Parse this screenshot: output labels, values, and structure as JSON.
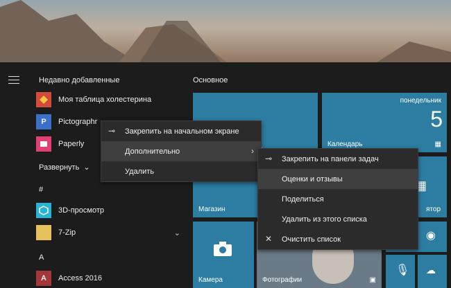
{
  "start_menu": {
    "recent_title": "Недавно добавленные",
    "main_title": "Основное",
    "recent_apps": [
      {
        "label": "Моя таблица холестерина",
        "icon": "cholesterol-app-icon",
        "color": "#d24c3a"
      },
      {
        "label": "Pictographr",
        "icon": "pictographr-icon",
        "color": "#3b6fc9"
      },
      {
        "label": "Paperly",
        "icon": "paperly-icon",
        "color": "#e23f72"
      }
    ],
    "expand_label": "Развернуть",
    "groups": [
      {
        "letter": "#",
        "apps": [
          {
            "label": "3D-просмотр",
            "icon": "3d-viewer-icon",
            "color": "#28b4d6"
          },
          {
            "label": "7-Zip",
            "icon": "folder-icon",
            "color": "#e4c15a"
          }
        ]
      },
      {
        "letter": "A",
        "apps": [
          {
            "label": "Access 2016",
            "icon": "access-icon",
            "color": "#a4373a"
          }
        ]
      }
    ]
  },
  "tiles": {
    "store_label": "Магазин",
    "calendar_label": "Календарь",
    "calendar_day": "понедельник",
    "calendar_date": "5",
    "camera_label": "Камера",
    "photos_label": "Фотографии",
    "partial_label": "ятор"
  },
  "context_menu": {
    "items": [
      "Закрепить на начальном экране",
      "Дополнительно",
      "Удалить"
    ]
  },
  "submenu": {
    "items": [
      "Закрепить на панели задач",
      "Оценки и отзывы",
      "Поделиться",
      "Удалить из этого списка",
      "Очистить список"
    ]
  },
  "colors": {
    "tile": "#2d7da2",
    "menu_bg": "#2b2b2b",
    "start_bg": "#1c1c1c"
  }
}
